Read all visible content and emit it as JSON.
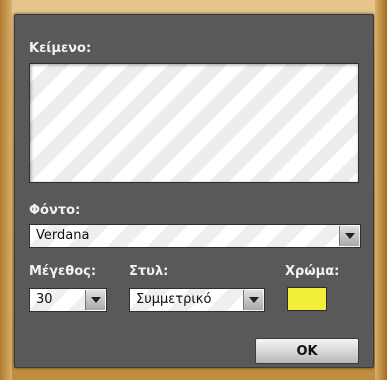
{
  "dialog": {
    "text_label": "Κείμενο:",
    "text_value": "",
    "font_label": "Φόντο:",
    "font_value": "Verdana",
    "size_label": "Μέγεθος:",
    "size_value": "30",
    "style_label": "Στυλ:",
    "style_value": "Συμμετρικό",
    "color_label": "Χρώμα:",
    "color_value": "#f2ef3a",
    "ok_label": "OK"
  },
  "icons": {
    "dropdown": "chevron-down-icon"
  }
}
